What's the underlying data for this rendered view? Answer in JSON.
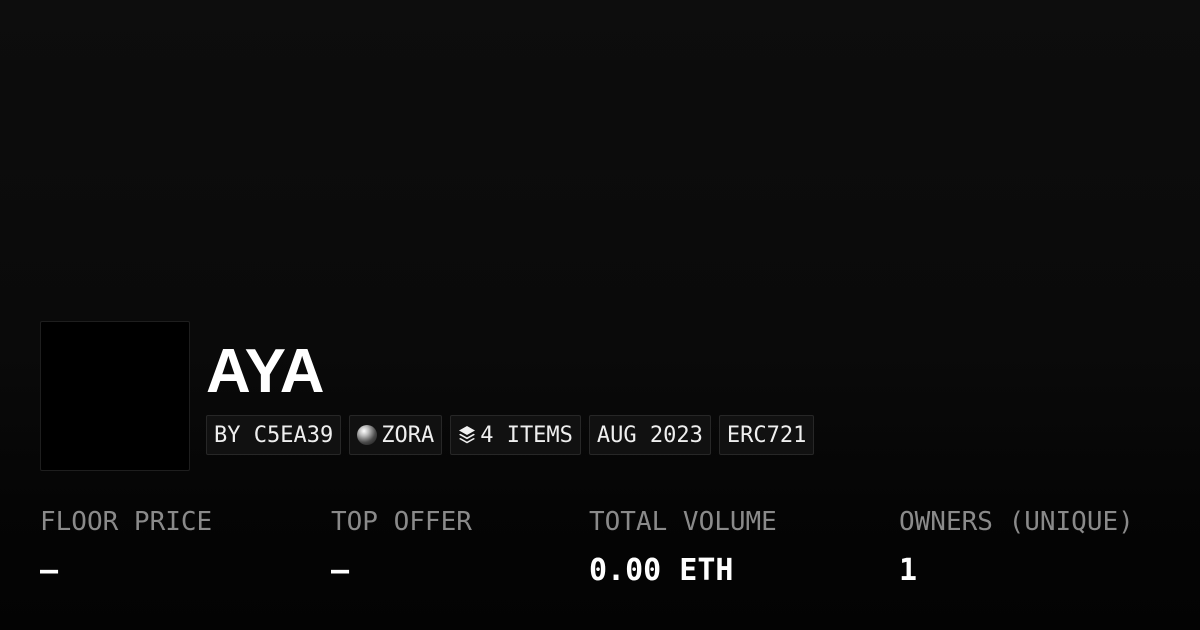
{
  "collection": {
    "name": "AYA",
    "tags": [
      {
        "label": "BY C5EA39",
        "icon": ""
      },
      {
        "label": "ZORA",
        "icon": "zora-network-icon"
      },
      {
        "label": "4 ITEMS",
        "icon": "layers-icon"
      },
      {
        "label": "AUG 2023",
        "icon": ""
      },
      {
        "label": "ERC721",
        "icon": ""
      }
    ]
  },
  "stats": [
    {
      "label": "FLOOR PRICE",
      "value": "–"
    },
    {
      "label": "TOP OFFER",
      "value": "–"
    },
    {
      "label": "TOTAL VOLUME",
      "value": "0.00 ETH"
    },
    {
      "label": "OWNERS (UNIQUE)",
      "value": "1"
    }
  ],
  "colors": {
    "background": "#0a0a0a",
    "text": "#ffffff",
    "muted": "#8a8a8a",
    "tag_bg": "#111111",
    "tag_border": "#272727"
  }
}
